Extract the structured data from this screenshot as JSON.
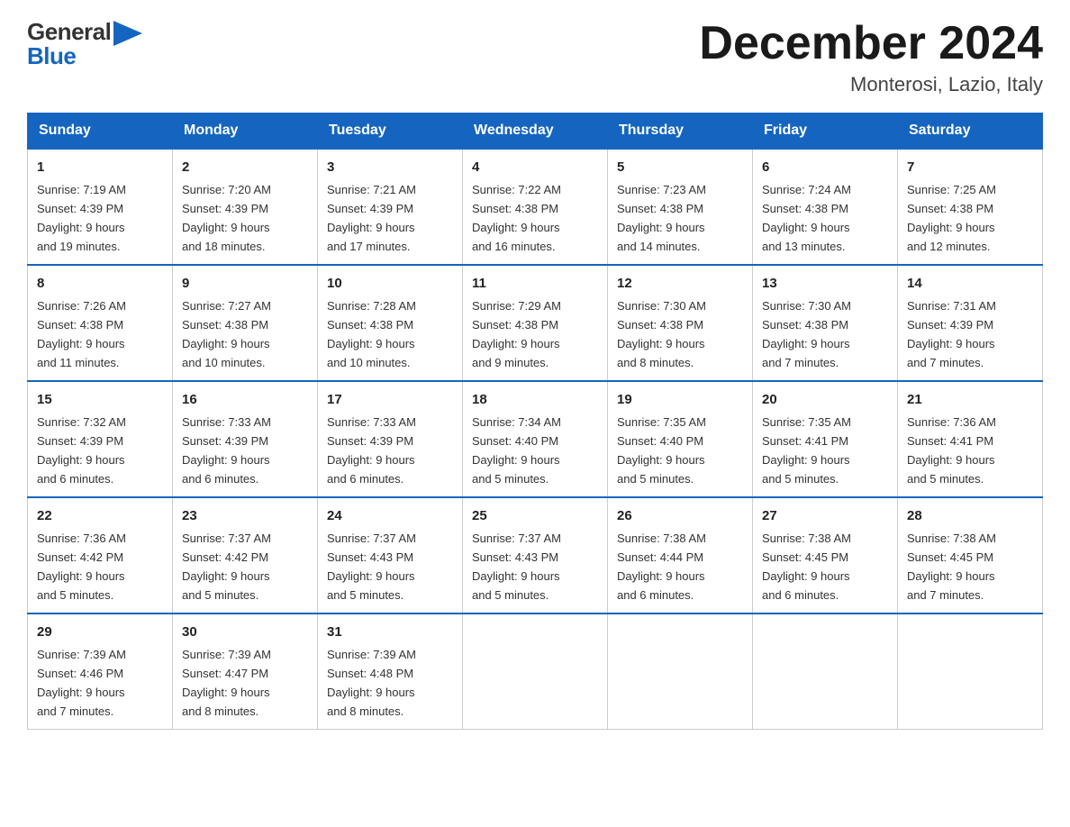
{
  "header": {
    "logo": {
      "general": "General",
      "blue": "Blue"
    },
    "title": "December 2024",
    "subtitle": "Monterosi, Lazio, Italy"
  },
  "calendar": {
    "weekdays": [
      "Sunday",
      "Monday",
      "Tuesday",
      "Wednesday",
      "Thursday",
      "Friday",
      "Saturday"
    ],
    "weeks": [
      [
        {
          "day": "1",
          "info": "Sunrise: 7:19 AM\nSunset: 4:39 PM\nDaylight: 9 hours\nand 19 minutes."
        },
        {
          "day": "2",
          "info": "Sunrise: 7:20 AM\nSunset: 4:39 PM\nDaylight: 9 hours\nand 18 minutes."
        },
        {
          "day": "3",
          "info": "Sunrise: 7:21 AM\nSunset: 4:39 PM\nDaylight: 9 hours\nand 17 minutes."
        },
        {
          "day": "4",
          "info": "Sunrise: 7:22 AM\nSunset: 4:38 PM\nDaylight: 9 hours\nand 16 minutes."
        },
        {
          "day": "5",
          "info": "Sunrise: 7:23 AM\nSunset: 4:38 PM\nDaylight: 9 hours\nand 14 minutes."
        },
        {
          "day": "6",
          "info": "Sunrise: 7:24 AM\nSunset: 4:38 PM\nDaylight: 9 hours\nand 13 minutes."
        },
        {
          "day": "7",
          "info": "Sunrise: 7:25 AM\nSunset: 4:38 PM\nDaylight: 9 hours\nand 12 minutes."
        }
      ],
      [
        {
          "day": "8",
          "info": "Sunrise: 7:26 AM\nSunset: 4:38 PM\nDaylight: 9 hours\nand 11 minutes."
        },
        {
          "day": "9",
          "info": "Sunrise: 7:27 AM\nSunset: 4:38 PM\nDaylight: 9 hours\nand 10 minutes."
        },
        {
          "day": "10",
          "info": "Sunrise: 7:28 AM\nSunset: 4:38 PM\nDaylight: 9 hours\nand 10 minutes."
        },
        {
          "day": "11",
          "info": "Sunrise: 7:29 AM\nSunset: 4:38 PM\nDaylight: 9 hours\nand 9 minutes."
        },
        {
          "day": "12",
          "info": "Sunrise: 7:30 AM\nSunset: 4:38 PM\nDaylight: 9 hours\nand 8 minutes."
        },
        {
          "day": "13",
          "info": "Sunrise: 7:30 AM\nSunset: 4:38 PM\nDaylight: 9 hours\nand 7 minutes."
        },
        {
          "day": "14",
          "info": "Sunrise: 7:31 AM\nSunset: 4:39 PM\nDaylight: 9 hours\nand 7 minutes."
        }
      ],
      [
        {
          "day": "15",
          "info": "Sunrise: 7:32 AM\nSunset: 4:39 PM\nDaylight: 9 hours\nand 6 minutes."
        },
        {
          "day": "16",
          "info": "Sunrise: 7:33 AM\nSunset: 4:39 PM\nDaylight: 9 hours\nand 6 minutes."
        },
        {
          "day": "17",
          "info": "Sunrise: 7:33 AM\nSunset: 4:39 PM\nDaylight: 9 hours\nand 6 minutes."
        },
        {
          "day": "18",
          "info": "Sunrise: 7:34 AM\nSunset: 4:40 PM\nDaylight: 9 hours\nand 5 minutes."
        },
        {
          "day": "19",
          "info": "Sunrise: 7:35 AM\nSunset: 4:40 PM\nDaylight: 9 hours\nand 5 minutes."
        },
        {
          "day": "20",
          "info": "Sunrise: 7:35 AM\nSunset: 4:41 PM\nDaylight: 9 hours\nand 5 minutes."
        },
        {
          "day": "21",
          "info": "Sunrise: 7:36 AM\nSunset: 4:41 PM\nDaylight: 9 hours\nand 5 minutes."
        }
      ],
      [
        {
          "day": "22",
          "info": "Sunrise: 7:36 AM\nSunset: 4:42 PM\nDaylight: 9 hours\nand 5 minutes."
        },
        {
          "day": "23",
          "info": "Sunrise: 7:37 AM\nSunset: 4:42 PM\nDaylight: 9 hours\nand 5 minutes."
        },
        {
          "day": "24",
          "info": "Sunrise: 7:37 AM\nSunset: 4:43 PM\nDaylight: 9 hours\nand 5 minutes."
        },
        {
          "day": "25",
          "info": "Sunrise: 7:37 AM\nSunset: 4:43 PM\nDaylight: 9 hours\nand 5 minutes."
        },
        {
          "day": "26",
          "info": "Sunrise: 7:38 AM\nSunset: 4:44 PM\nDaylight: 9 hours\nand 6 minutes."
        },
        {
          "day": "27",
          "info": "Sunrise: 7:38 AM\nSunset: 4:45 PM\nDaylight: 9 hours\nand 6 minutes."
        },
        {
          "day": "28",
          "info": "Sunrise: 7:38 AM\nSunset: 4:45 PM\nDaylight: 9 hours\nand 7 minutes."
        }
      ],
      [
        {
          "day": "29",
          "info": "Sunrise: 7:39 AM\nSunset: 4:46 PM\nDaylight: 9 hours\nand 7 minutes."
        },
        {
          "day": "30",
          "info": "Sunrise: 7:39 AM\nSunset: 4:47 PM\nDaylight: 9 hours\nand 8 minutes."
        },
        {
          "day": "31",
          "info": "Sunrise: 7:39 AM\nSunset: 4:48 PM\nDaylight: 9 hours\nand 8 minutes."
        },
        null,
        null,
        null,
        null
      ]
    ]
  }
}
